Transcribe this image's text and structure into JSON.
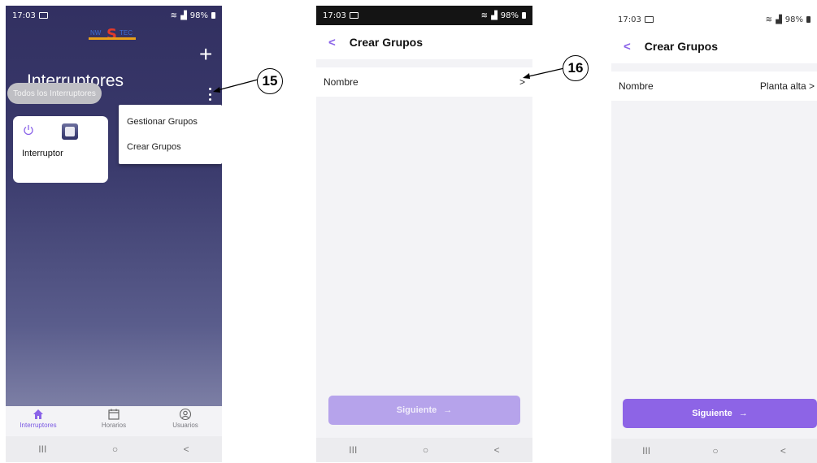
{
  "status_bar": {
    "time": "17:03",
    "battery": "98%"
  },
  "phone1": {
    "title": "Interruptores",
    "add_label": "+",
    "filter_chip": "Todos los Interruptores",
    "menu_items": [
      "Gestionar Grupos",
      "Crear Grupos"
    ],
    "device_label": "Interruptor",
    "tabs": [
      {
        "label": "Interruptores",
        "icon": "home-icon",
        "active": true
      },
      {
        "label": "Horarios",
        "icon": "calendar-icon",
        "active": false
      },
      {
        "label": "Usuarios",
        "icon": "user-icon",
        "active": false
      }
    ]
  },
  "phone2": {
    "back_label": "<",
    "title": "Crear Grupos",
    "field_label": "Nombre",
    "field_value": "",
    "field_chevron": ">",
    "next_button": "Siguiente",
    "next_enabled": false
  },
  "phone3": {
    "back_label": "<",
    "title": "Crear Grupos",
    "field_label": "Nombre",
    "field_value": "Planta alta",
    "field_chevron": ">",
    "next_button": "Siguiente",
    "next_enabled": true
  },
  "nav_buttons": {
    "recents": "III",
    "home": "○",
    "back": "<"
  },
  "arrow_glyph": "→",
  "callouts": [
    "15",
    "16"
  ],
  "colors": {
    "accent": "#8d64e6",
    "accent_disabled": "#b6a3eb",
    "header_dark": "#323061"
  }
}
